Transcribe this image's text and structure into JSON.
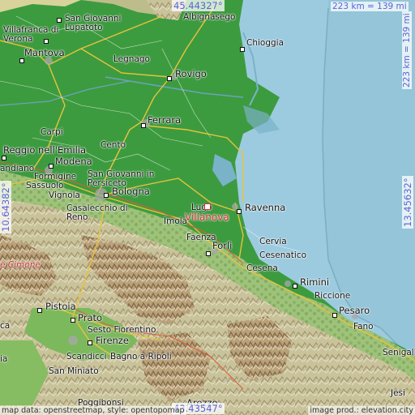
{
  "map": {
    "coords": {
      "top": "45.44327°",
      "bottom": "43.43547°",
      "left": "10.64382°",
      "right": "13.45632°"
    },
    "scale": {
      "top": "223 km = 139 mi",
      "right": "223 km = 139 mi"
    },
    "credits": {
      "left": "map data: openstreetmap, style: opentopomap",
      "right": "image prod.: elevation.city"
    },
    "marker": {
      "name": "Villanova",
      "color": "#e0303a"
    },
    "places": [
      {
        "id": "san-giovanni-lupatoto",
        "lines": [
          "San Giovanni",
          "Lupatoto"
        ]
      },
      {
        "id": "villafranca",
        "lines": [
          "Villafranca di",
          "Verona"
        ]
      },
      {
        "id": "albignasego",
        "text": "Albignasego"
      },
      {
        "id": "chioggia",
        "text": "Chioggia"
      },
      {
        "id": "mantova",
        "text": "Mantova"
      },
      {
        "id": "legnago",
        "text": "Legnago"
      },
      {
        "id": "rovigo",
        "text": "Rovigo"
      },
      {
        "id": "ferrara",
        "text": "Ferrara"
      },
      {
        "id": "carpi",
        "text": "Carpi"
      },
      {
        "id": "cento",
        "text": "Cento"
      },
      {
        "id": "reggio-emilia",
        "text": "Reggio nell'Emilia"
      },
      {
        "id": "modena",
        "text": "Modena"
      },
      {
        "id": "scandiano",
        "text": "andiano"
      },
      {
        "id": "formigine",
        "text": "Formigine"
      },
      {
        "id": "sassuolo",
        "text": "Sassuolo"
      },
      {
        "id": "san-giovanni-persiceto",
        "lines": [
          "San Giovanni in",
          "Persiceto"
        ]
      },
      {
        "id": "vignola",
        "text": "Vignola"
      },
      {
        "id": "bologna",
        "text": "Bologna"
      },
      {
        "id": "casalecchio",
        "lines": [
          "Casalecchio di",
          "Reno"
        ]
      },
      {
        "id": "lugo",
        "text": "Lugo"
      },
      {
        "id": "ravenna",
        "text": "Ravenna"
      },
      {
        "id": "imola",
        "text": "Imola"
      },
      {
        "id": "faenza",
        "text": "Faenza"
      },
      {
        "id": "forli",
        "text": "Forlì"
      },
      {
        "id": "cervia",
        "text": "Cervia"
      },
      {
        "id": "cesenatico",
        "text": "Cesenatico"
      },
      {
        "id": "cesena",
        "text": "Cesena"
      },
      {
        "id": "monte-cimone",
        "text": "e Cimone"
      },
      {
        "id": "rimini",
        "text": "Rimini"
      },
      {
        "id": "riccione",
        "text": "Riccione"
      },
      {
        "id": "pesaro",
        "text": "Pesaro"
      },
      {
        "id": "pistoia",
        "text": "Pistoia"
      },
      {
        "id": "prato",
        "text": "Prato"
      },
      {
        "id": "sesto-fiorentino",
        "text": "Sesto Fiorentino"
      },
      {
        "id": "fano",
        "text": "Fano"
      },
      {
        "id": "firenze",
        "text": "Firenze"
      },
      {
        "id": "scandicci",
        "text": "Scandicci"
      },
      {
        "id": "bagno-a-ripoli",
        "text": "Bagno a Ripoli"
      },
      {
        "id": "senigallia",
        "text": "Senigalli"
      },
      {
        "id": "san-miniato",
        "text": "San Miniato"
      },
      {
        "id": "jesi",
        "text": "Jesi"
      },
      {
        "id": "poggibonsi",
        "text": "Poggibonsi"
      },
      {
        "id": "arezzo",
        "text": "Arezzo"
      },
      {
        "id": "lucca",
        "text": "ca"
      },
      {
        "id": "pescia",
        "text": "ia"
      }
    ]
  }
}
